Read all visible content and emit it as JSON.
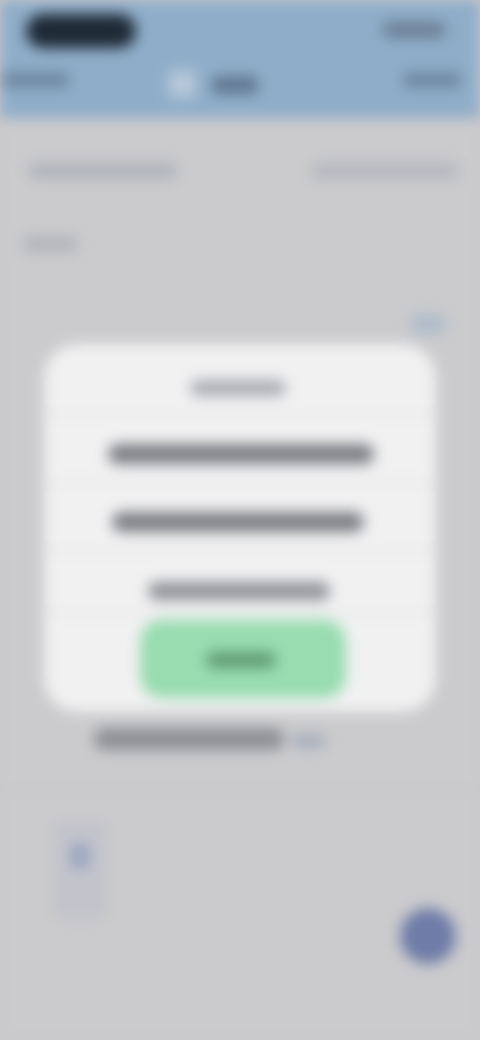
{
  "header": {
    "status_time": "",
    "back_label": "",
    "title": "",
    "action_label": ""
  },
  "background": {
    "tab_left": "",
    "tab_right": "",
    "section_label": "",
    "list_item": "",
    "list_item_meta": ""
  },
  "dialog": {
    "title": "",
    "option_1": "",
    "option_2": "",
    "secondary_action": "",
    "primary_action": ""
  },
  "colors": {
    "header": "#8fadc9",
    "dialog": "#f1f1f2",
    "confirm": "#98dcb0",
    "fab": "#6f7ca8",
    "background": "#cbcbcd"
  }
}
